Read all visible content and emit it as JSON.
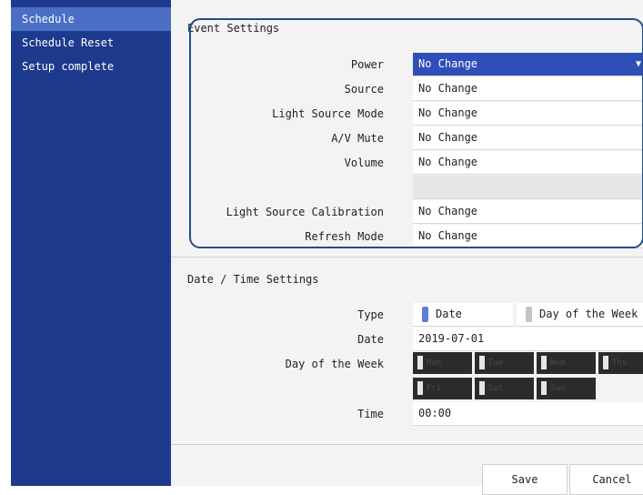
{
  "sidebar": {
    "items": [
      {
        "label": "Schedule"
      },
      {
        "label": "Schedule Reset"
      },
      {
        "label": "Setup complete"
      }
    ]
  },
  "event_settings": {
    "title": "Event Settings",
    "rows": [
      {
        "label": "Power",
        "value": "No Change"
      },
      {
        "label": "Source",
        "value": "No Change"
      },
      {
        "label": "Light Source Mode",
        "value": "No Change"
      },
      {
        "label": "A/V Mute",
        "value": "No Change"
      },
      {
        "label": "Volume",
        "value": "No Change"
      },
      {
        "label": "Light Source Calibration",
        "value": "No Change"
      },
      {
        "label": "Refresh Mode",
        "value": "No Change"
      }
    ]
  },
  "datetime": {
    "title": "Date / Time Settings",
    "type_label": "Type",
    "type_options": [
      "Date",
      "Day of the Week"
    ],
    "type_selected": "Date",
    "date_label": "Date",
    "date_value": "2019-07-01",
    "dow_label": "Day of the Week",
    "days": [
      "Mon",
      "Tue",
      "Wed",
      "Thu",
      "Fri",
      "Sat",
      "Sun"
    ],
    "time_label": "Time",
    "time_value": "00:00"
  },
  "footer": {
    "save_label": "Save",
    "cancel_label": "Cancel"
  },
  "colors": {
    "sidebar_bg": "#1e3a8c",
    "sidebar_active": "#4a6fc5",
    "selected_field": "#2f4fb8",
    "highlight_border": "#1d4f8c"
  }
}
